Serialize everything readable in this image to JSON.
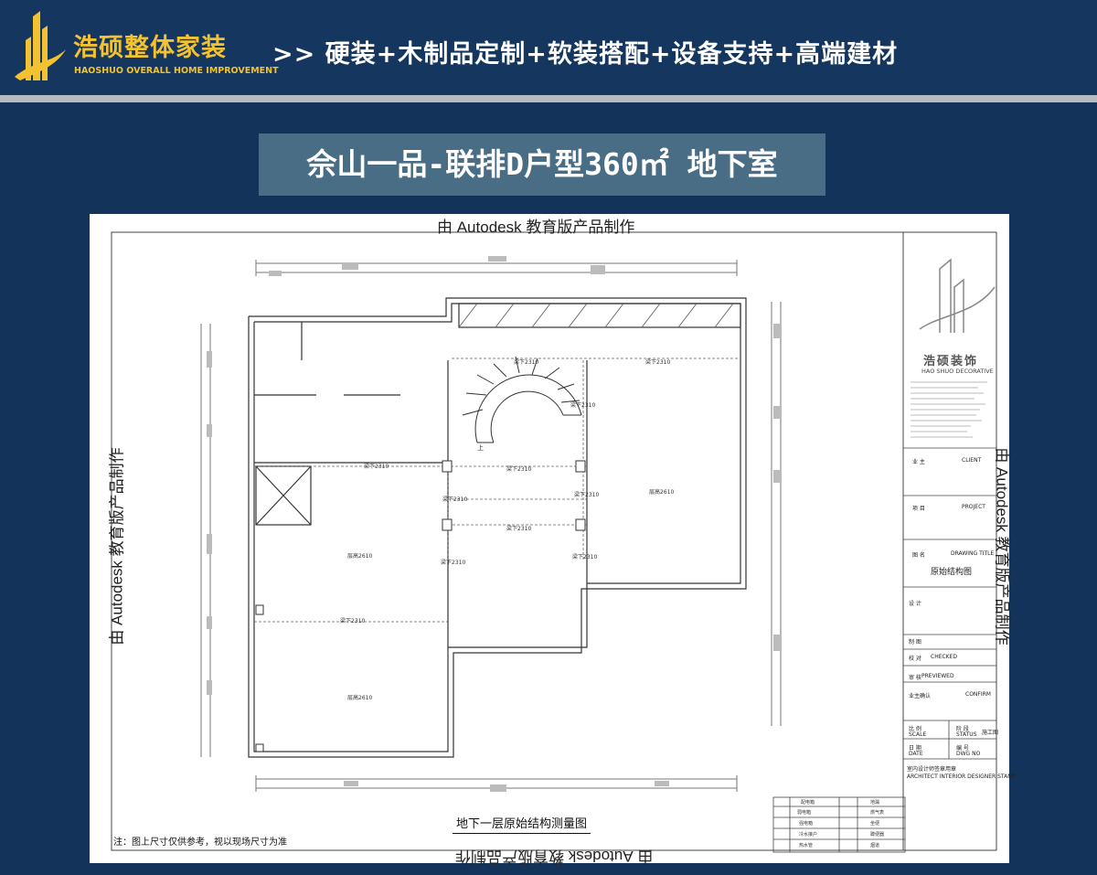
{
  "header": {
    "brand_name": "浩硕整体家装",
    "brand_subtitle": "HAOSHUO OVERALL HOME IMPROVEMENT",
    "tagline": ">> 硬装+木制品定制+软装搭配+设备支持+高端建材"
  },
  "title": "佘山一品-联排D户型360㎡ 地下室",
  "drawing": {
    "watermark": "由 Autodesk 教育版产品制作",
    "caption": "地下一层原始结构测量图",
    "note": "注：图上尺寸仅供参考，视以现场尺寸为准",
    "beam_label": "梁下2310",
    "height_label": "层高2610",
    "upstairs_mark": "上"
  },
  "title_block": {
    "company_cn": "浩硕装饰",
    "company_en": "HAO SHUO DECORATIVE",
    "client_label": "业 主",
    "client_en": "CLIENT",
    "project_label": "项 目",
    "project_en": "PROJECT",
    "drawing_title_label": "图 名",
    "drawing_title_en": "DRAWING TITLE",
    "drawing_title_value": "原始结构图",
    "design_label": "设 计",
    "draw_label": "制 图",
    "check_label": "校 对",
    "check_en": "CHECKED",
    "review_label": "审 核",
    "review_en": "PREVIEWED",
    "confirm_label": "业主确认",
    "confirm_en": "CONFIRM",
    "scale_label": "比 例",
    "scale_en": "SCALE",
    "stage_label": "阶 段",
    "stage_en": "STATUS",
    "stage_value": "施工图",
    "date_label": "日 期",
    "date_en": "DATE",
    "number_label": "编 号",
    "number_en": "DWG NO",
    "stamp_label": "室内设计师签章用章",
    "stamp_en": "ARCHITECT  INTERIOR DESIGNER STAMP"
  },
  "legend": {
    "items": [
      "配电箱",
      "弱电箱",
      "强电箱",
      "冷水接户",
      "热水管",
      "地漏",
      "燃气表",
      "坐便",
      "蹲便器",
      "烟道"
    ]
  },
  "colors": {
    "page_bg": "#13335a",
    "brand_gold": "#f2c230",
    "title_box": "#4a6d86",
    "rule_gray": "#b6bbc2"
  }
}
